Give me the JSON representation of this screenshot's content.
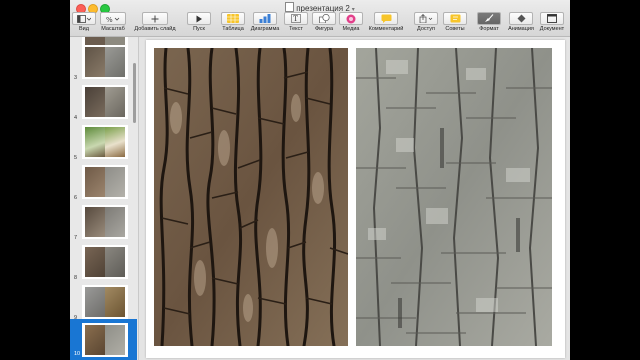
{
  "window": {
    "title": "презентация 2"
  },
  "toolbar": {
    "items": [
      {
        "label": "Вид",
        "icon": "sidebar-view-icon"
      },
      {
        "label": "Масштаб",
        "icon": "zoom-percent-icon"
      },
      {
        "label": "Добавить слайд",
        "icon": "plus-icon"
      },
      {
        "label": "Пуск",
        "icon": "play-icon"
      },
      {
        "label": "Таблица",
        "icon": "table-icon"
      },
      {
        "label": "Диаграмма",
        "icon": "chart-icon"
      },
      {
        "label": "Текст",
        "icon": "text-icon"
      },
      {
        "label": "Фигура",
        "icon": "shape-icon"
      },
      {
        "label": "Медиа",
        "icon": "media-icon"
      },
      {
        "label": "Комментарий",
        "icon": "comment-icon"
      },
      {
        "label": "Доступ",
        "icon": "share-icon"
      },
      {
        "label": "Советы",
        "icon": "tips-icon"
      },
      {
        "label": "Формат",
        "icon": "format-brush-icon"
      },
      {
        "label": "Анимация",
        "icon": "animation-diamond-icon"
      },
      {
        "label": "Документ",
        "icon": "document-icon"
      }
    ]
  },
  "sidebar": {
    "slides": [
      {
        "number": "3"
      },
      {
        "number": "4"
      },
      {
        "number": "5"
      },
      {
        "number": "6"
      },
      {
        "number": "7"
      },
      {
        "number": "8"
      },
      {
        "number": "9"
      },
      {
        "number": "10",
        "selected": true
      }
    ]
  },
  "slide": {
    "images": [
      {
        "name": "oak-bark-photo",
        "tone": "#6e5a45"
      },
      {
        "name": "birch-bark-photo",
        "tone": "#9a9c94"
      }
    ]
  },
  "colors": {
    "selection": "#1976d3",
    "toolbar_accent_yellow": "#f7c52a",
    "toolbar_accent_blue": "#3a7fd6",
    "toolbar_accent_pink": "#e23f8a"
  }
}
